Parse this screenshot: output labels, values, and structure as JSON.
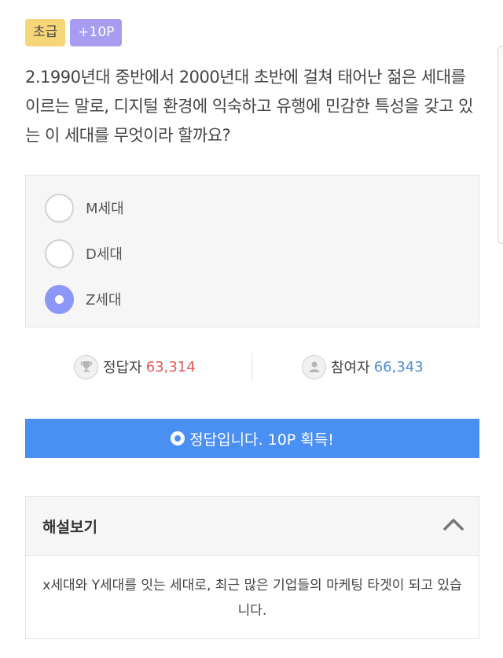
{
  "badges": {
    "level": "초급",
    "points": "+10P"
  },
  "question": {
    "text": "2.1990년대 중반에서 2000년대 초반에 걸쳐 태어난 젊은 세대를 이르는 말로, 디지털 환경에 익숙하고 유행에 민감한 특성을 갖고 있는 이 세대를 무엇이라 할까요?"
  },
  "options": [
    {
      "label": "M세대",
      "selected": false
    },
    {
      "label": "D세대",
      "selected": false
    },
    {
      "label": "Z세대",
      "selected": true
    }
  ],
  "stats": {
    "correct_label": "정답자",
    "correct_value": "63,314",
    "participants_label": "참여자",
    "participants_value": "66,343"
  },
  "result": {
    "text": "정답입니다. 10P 획득!"
  },
  "explanation": {
    "title": "해설보기",
    "body": "x세대와 Y세대를 잇는 세대로, 최근 많은 기업들의 마케팅 타겟이 되고 있습니다.",
    "expanded": true
  },
  "colors": {
    "level_badge": "#f7d67a",
    "points_badge": "#a79cf0",
    "selected_radio": "#8d97f7",
    "result_bar": "#4a8ff2",
    "correct_value": "#dd5a5a",
    "participants_value": "#4e8fd4"
  },
  "icons": {
    "correct": "trophy-icon",
    "participants": "user-icon",
    "result": "circle-check-icon",
    "explanation_toggle": "chevron-up-icon"
  }
}
